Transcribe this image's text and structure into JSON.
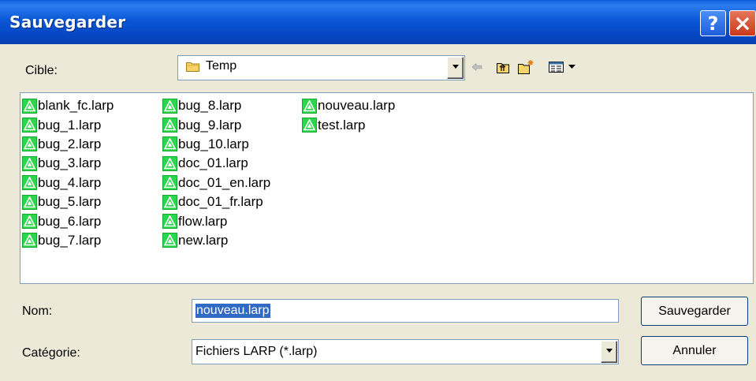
{
  "window": {
    "title": "Sauvegarder",
    "help_glyph": "?"
  },
  "location": {
    "label": "Cible:",
    "value": "Temp"
  },
  "files": {
    "columns": [
      [
        "blank_fc.larp",
        "bug_1.larp",
        "bug_2.larp",
        "bug_3.larp",
        "bug_4.larp",
        "bug_5.larp",
        "bug_6.larp",
        "bug_7.larp"
      ],
      [
        "bug_8.larp",
        "bug_9.larp",
        "bug_10.larp",
        "doc_01.larp",
        "doc_01_en.larp",
        "doc_01_fr.larp",
        "flow.larp",
        "new.larp"
      ],
      [
        "nouveau.larp",
        "test.larp"
      ]
    ]
  },
  "name_field": {
    "label": "Nom:",
    "value": "nouveau.larp"
  },
  "category_field": {
    "label": "Catégorie:",
    "value": "Fichiers LARP (*.larp)"
  },
  "buttons": {
    "save": "Sauvegarder",
    "cancel": "Annuler"
  },
  "icons": {
    "back": "back-arrow-icon",
    "up": "up-folder-icon",
    "new_folder": "new-folder-icon",
    "view": "view-menu-icon",
    "file": "larp-file-icon"
  },
  "colors": {
    "titlebar": "#0b57d6",
    "selection": "#316ac5",
    "file_icon": "#2bd64c",
    "dialog_bg": "#ece9d8"
  }
}
